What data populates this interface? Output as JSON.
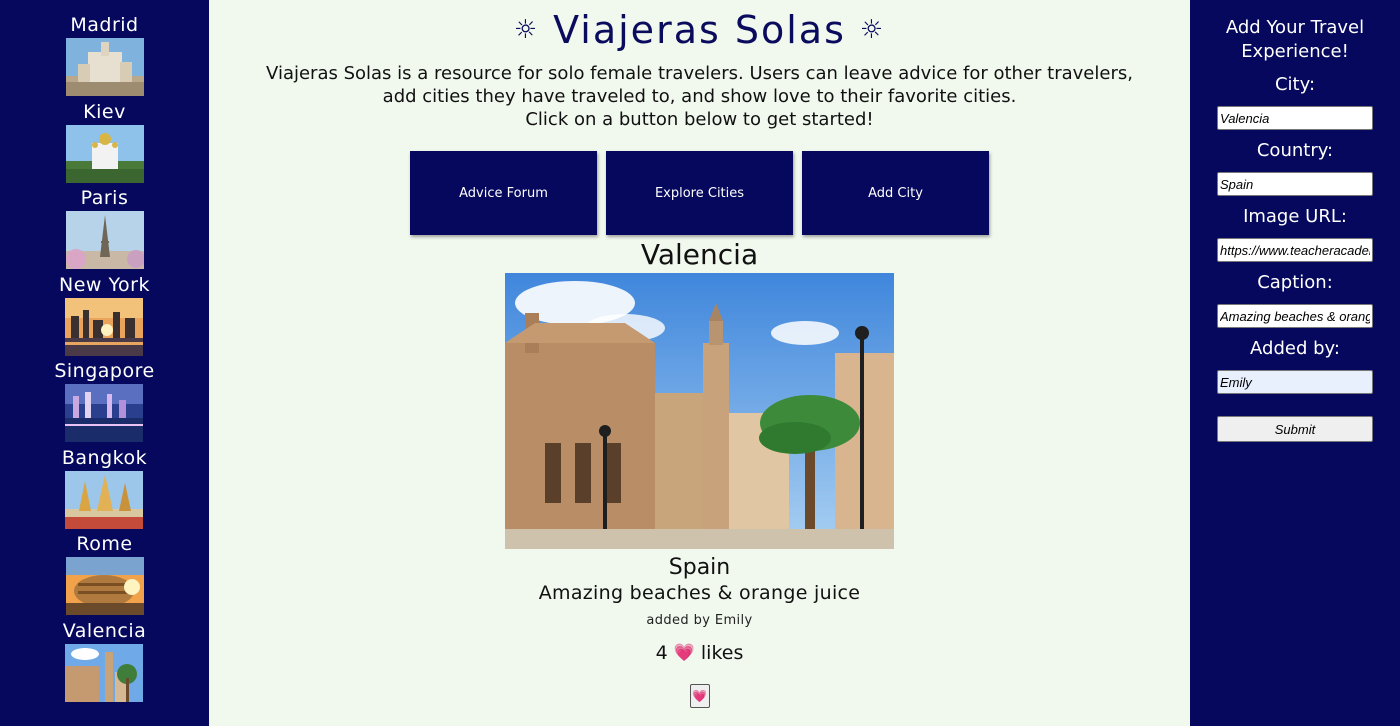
{
  "sidebar": {
    "cities": [
      {
        "name": "Madrid",
        "thumb": "madrid"
      },
      {
        "name": "Kiev",
        "thumb": "kiev"
      },
      {
        "name": "Paris",
        "thumb": "paris"
      },
      {
        "name": "New York",
        "thumb": "newyork"
      },
      {
        "name": "Singapore",
        "thumb": "singapore"
      },
      {
        "name": "Bangkok",
        "thumb": "bangkok"
      },
      {
        "name": "Rome",
        "thumb": "rome"
      },
      {
        "name": "Valencia",
        "thumb": "valencia"
      }
    ]
  },
  "header": {
    "title": "Viajeras Solas",
    "icon": "sun-icon",
    "intro_line1": "Viajeras Solas is a resource for solo female travelers. Users can leave advice for other travelers,",
    "intro_line2": "add cities they have traveled to, and show love to their favorite cities.",
    "intro_line3": "Click on a button below to get started!"
  },
  "nav": {
    "advice_label": "Advice Forum",
    "explore_label": "Explore Cities",
    "add_label": "Add City"
  },
  "featured": {
    "city": "Valencia",
    "country": "Spain",
    "caption": "Amazing beaches & orange juice",
    "added_by": "added by Emily",
    "likes_count": "4",
    "likes_label": "likes",
    "heart": "💗"
  },
  "form": {
    "title": "Add Your Travel Experience!",
    "city_label": "City:",
    "city_value": "Valencia",
    "country_label": "Country:",
    "country_value": "Spain",
    "image_label": "Image URL:",
    "image_value": "https://www.teacheracademy.eu",
    "caption_label": "Caption:",
    "caption_value": "Amazing beaches & orange juice",
    "addedby_label": "Added by:",
    "addedby_value": "Emily",
    "submit_label": "Submit"
  },
  "colors": {
    "navy": "#05085c",
    "main_bg": "#f1f8ee"
  }
}
